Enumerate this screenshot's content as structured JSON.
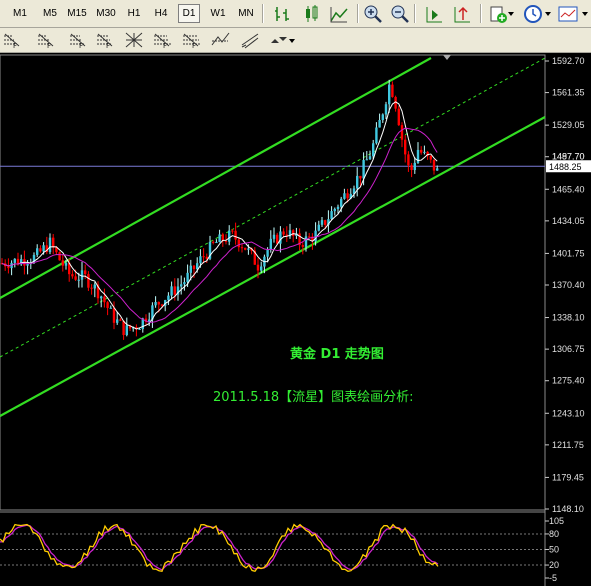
{
  "toolbar": {
    "timeframes": [
      "M1",
      "M5",
      "M15",
      "M30",
      "H1",
      "H4",
      "D1",
      "W1",
      "MN"
    ],
    "active_timeframe": "D1",
    "icons": [
      "bar-chart-icon",
      "candlestick-icon",
      "line-chart-icon",
      "zoom-in-icon",
      "zoom-out-icon",
      "chart-shift-icon",
      "auto-scroll-icon",
      "new-order-icon",
      "history-icon",
      "templates-icon"
    ]
  },
  "drawing_toolbar": {
    "icons": [
      "fibo-retracement-icon",
      "fibo-fan-icon",
      "fibo-arcs-icon",
      "fibo-grid-icon",
      "gann-grid-icon",
      "fibo-channel-icon",
      "andrews-pitchfork-icon",
      "regression-channel-icon",
      "std-deviation-icon",
      "arrows-icon"
    ]
  },
  "chart": {
    "title_text": "黄金  D1  走势图",
    "annotation_text": "2011.5.18【流星】图表绘画分析:",
    "current_price": "1488.25",
    "bid_label": "1487.70",
    "price_scale": [
      "1592.70",
      "1561.35",
      "1529.05",
      "1497.70",
      "1465.40",
      "1434.05",
      "1401.75",
      "1370.40",
      "1338.10",
      "1306.75",
      "1275.40",
      "1243.10",
      "1211.75",
      "1179.45",
      "1148.10"
    ],
    "indicator_scale": [
      "105",
      "80",
      "50",
      "20",
      "-5"
    ],
    "colors": {
      "background": "#000000",
      "bull_candle": "#ffffff",
      "bear_candle": "#ff0000",
      "up_body": "#40c8e0",
      "channel": "#33dd22",
      "ma_fast": "#ffffff",
      "ma_slow": "#cc22cc",
      "text_green": "#33ee33",
      "stoch_main": "#ffcc00",
      "stoch_signal": "#cc22cc"
    }
  }
}
